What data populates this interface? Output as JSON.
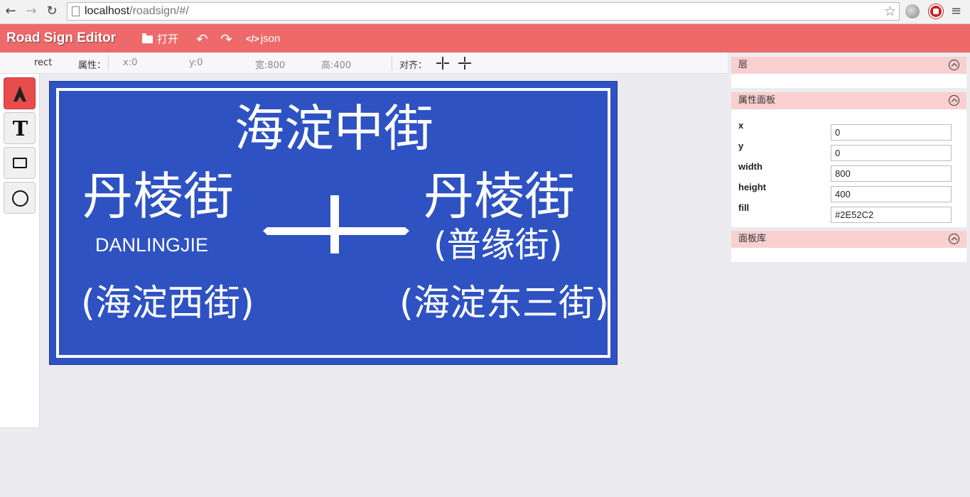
{
  "browser": {
    "url_host": "localhost",
    "url_path": "/roadsign/#/"
  },
  "app": {
    "title": "Road Sign Editor",
    "toolbar": {
      "open_label": "打开",
      "undo_icon": "↶",
      "redo_icon": "↷",
      "json_code_icon": "</>",
      "json_label": "json"
    }
  },
  "propbar": {
    "type": "rect",
    "attr_label": "属性：",
    "x": "x:0",
    "y": "y:0",
    "width": "宽:800",
    "height": "高:400",
    "align_label": "对齐："
  },
  "tools": [
    {
      "name": "select",
      "icon": "arrow-icon",
      "active": true
    },
    {
      "name": "text",
      "icon": "text-icon",
      "glyph": "T"
    },
    {
      "name": "rect",
      "icon": "rectangle-icon"
    },
    {
      "name": "circle",
      "icon": "circle-icon"
    }
  ],
  "sign": {
    "fill": "#2E52C2",
    "title": "海淀中街",
    "left_main": "丹棱街",
    "left_pinyin": "DANLINGJIE",
    "left_sub": "(海淀西街)",
    "right_main": "丹棱街",
    "right_sub1": "(普缘街)",
    "right_sub2": "(海淀东三街)"
  },
  "panels": {
    "layers": {
      "title": "层"
    },
    "properties": {
      "title": "属性面板",
      "fields": [
        {
          "label": "x",
          "value": "0"
        },
        {
          "label": "y",
          "value": "0"
        },
        {
          "label": "width",
          "value": "800"
        },
        {
          "label": "height",
          "value": "400"
        },
        {
          "label": "fill",
          "value": "#2E52C2"
        }
      ]
    },
    "library": {
      "title": "面板库"
    }
  },
  "colors": {
    "appbar": "#ee6a6a",
    "panel_header": "#f9cfcf",
    "active_tool": "#e84c4c"
  }
}
